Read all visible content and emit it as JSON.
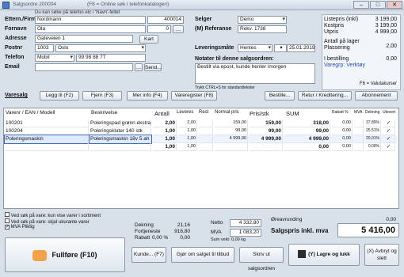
{
  "window": {
    "title": "Salgsordre 200004",
    "hint": "(F8 = Online søk i telefonkatalogen)",
    "min": "–",
    "max": "□",
    "close": "✕"
  },
  "customer": {
    "hint": "Du kan søke på telefon etc i 'Navn'-feltet",
    "etternavn_label": "Ettern./Firma",
    "etternavn": "Nordmann",
    "kundenr": "400014",
    "fornavn_label": "Fornavn",
    "fornavn": "Ola",
    "fornavn_num": "0",
    "adresse_label": "Adresse",
    "adresse": "Gateveien 1",
    "kart_button": "Kart",
    "postnr_label": "Postnr",
    "postnr": "1003",
    "poststed": "Oslo",
    "telefon_label": "Telefon",
    "telefon_type": "Mobil",
    "telefon": "99 98 88 77",
    "email_label": "Email",
    "email": "",
    "send_button": "Send..."
  },
  "order": {
    "selger_label": "Selger",
    "selger": "Demo",
    "referanse_label": "(M) Referanse",
    "referanse": "Rekv. 1738",
    "levering_label": "Leveringsmåte",
    "levering": "Hentes",
    "dato": "25.01.2019",
    "notat_label": "Notater til denne salgsordren:",
    "notat": "Bestilt via epost, kunde henter imorgen",
    "notat_hint": "Trykk CTRL+S for standardtekster"
  },
  "summary": {
    "listepris_label": "Listepris (inkl)",
    "listepris": "3 199,00",
    "kostpris_label": "Kostpris",
    "kostpris": "3 199,00",
    "utpris_label": "Utpris",
    "utpris": "4 999,00",
    "antall_label": "Antall på lager",
    "antall": "2,00",
    "plassering_label": "Plassering",
    "plassering": "",
    "ibestilling_label": "I bestilling",
    "ibestilling": "0,00",
    "varegr": "Varegrp: Verktøy",
    "valuta_hint": "F6 = Valutakurser"
  },
  "toolbar": {
    "varesalg": "Varesalg",
    "legg_til": "Legg til (F2)",
    "fjern": "Fjern (F3)",
    "mer_info": "Mer info (F4)",
    "vareregister": "Vareregister (F8)",
    "bestille": "Bestille...",
    "retur": "Retur / Kreditering...",
    "abonnement": "Abonnement"
  },
  "table": {
    "headers": [
      "Varenr / EAN / Modell",
      "Beskrivelse",
      "Antall",
      "Leveres",
      "Rest",
      "Normal pris",
      "Pris/stk",
      "SUM",
      "Rabatt %",
      "MVA",
      "Dekning",
      "Utevert"
    ],
    "rows": [
      {
        "varenr": "100201",
        "beskrivelse": "Poleringspad grønn ekstra hard",
        "antall": "2,00",
        "leveres": "2,00",
        "rest": "",
        "normal": "159,00",
        "pris": "159,00",
        "sum": "318,00",
        "rabatt": "0,00",
        "mva": "",
        "dekning": "37,89%",
        "ute": "✓"
      },
      {
        "varenr": "100204",
        "beskrivelse": "Poleringskluter 140 stk",
        "antall": "1,00",
        "leveres": "1,00",
        "rest": "",
        "normal": "99,00",
        "pris": "99,00",
        "sum": "99,00",
        "rabatt": "0,00",
        "mva": "",
        "dekning": "25,51%",
        "ute": "✓"
      },
      {
        "varenr": "Poleringsmaskin",
        "beskrivelse": "Poleringsmaskin 18v 5.ah",
        "antall": "1,00",
        "leveres": "1,00",
        "rest": "",
        "normal": "4 999,00",
        "pris": "4 999,00",
        "sum": "4 999,00",
        "rabatt": "0,00",
        "mva": "",
        "dekning": "20,01%",
        "ute": "✓"
      },
      {
        "varenr": "",
        "beskrivelse": "",
        "antall": "1,00",
        "leveres": "1,00",
        "rest": "",
        "normal": "",
        "pris": "",
        "sum": "0,00",
        "rabatt": "0,00",
        "mva": "",
        "dekning": "0,00%",
        "ute": "✓"
      }
    ]
  },
  "footer": {
    "opt1": "Ved søk på vare: kun vise varer i sortiment",
    "opt2": "Ved søk på vare: skjul ukurante varer",
    "opt3": "MVA Pliktig",
    "dekning_label": "Dekning",
    "dekning": "21,16",
    "fortjeneste_label": "Fortjeneste",
    "fortjeneste": "916,80",
    "rabatt_label": "Rabatt",
    "rabatt_pct": "0,00 %",
    "rabatt": "0,00",
    "netto_label": "Netto",
    "netto": "4 332,80",
    "mva_label": "MVA",
    "mva": "1 083,20",
    "vekt": "Sum vekt: 0,00 kg",
    "oreavrunding_label": "Øreavrunding",
    "oreavrunding": "0,00",
    "salgspris_label": "Salgspris inkl. mva",
    "salgspris": "5 416,00"
  },
  "actions": {
    "fullfore": "Fullføre (F10)",
    "kunde": "Kunde... (F7)",
    "tilbud": "Gjør om salget til tilbud",
    "skriv_ut": "Skriv ut salgsordren",
    "lagre": "(Y) Lagre og lukk",
    "avbryt": "(X) Avbryt og slett"
  }
}
